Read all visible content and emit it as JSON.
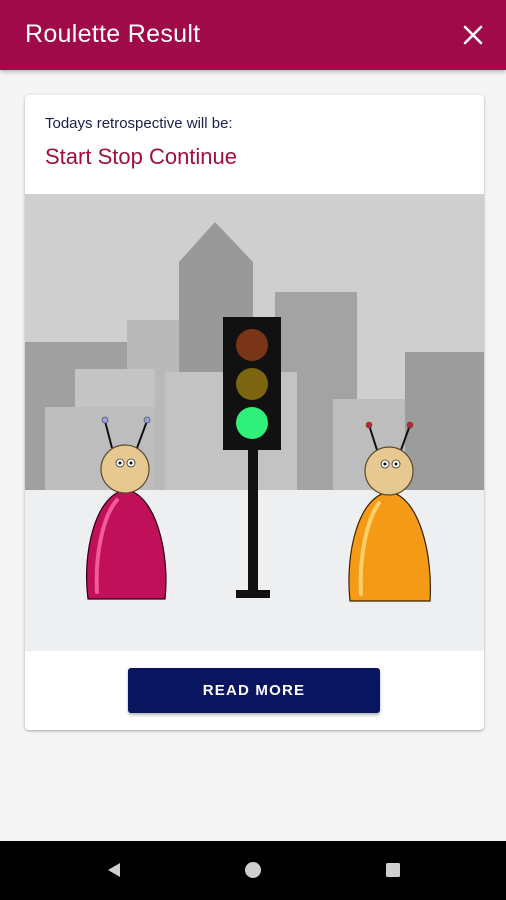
{
  "app_bar": {
    "title": "Roulette Result",
    "background_color": "#a10a48",
    "close_icon": "close-icon"
  },
  "card": {
    "subtitle": "Todays retrospective will be:",
    "title": "Start Stop Continue",
    "title_color": "#9d0f43",
    "illustration": {
      "description_icons": [
        "city-skyline",
        "traffic-light",
        "pink-character",
        "orange-character"
      ],
      "traffic_light_active": "green",
      "colors": {
        "sky": "#cfcfcf",
        "ground": "#eeeff1",
        "pink_character": "#c0105a",
        "orange_character": "#f59a16",
        "green_light": "#2ef07a"
      }
    },
    "button_label": "READ MORE",
    "button_color": "#0a1560"
  },
  "nav_bar": {
    "back_icon": "back-triangle-icon",
    "home_icon": "home-circle-icon",
    "recents_icon": "recents-square-icon"
  }
}
